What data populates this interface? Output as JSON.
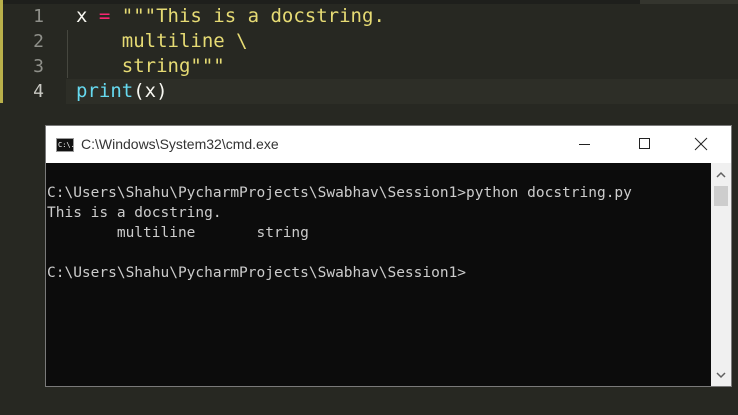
{
  "editor": {
    "line_numbers": [
      "1",
      "2",
      "3",
      "4"
    ],
    "lines": [
      {
        "var": "x",
        "op": " = ",
        "str": "\"\"\"This is a docstring."
      },
      {
        "str": "    multiline \\"
      },
      {
        "str": "    string\"\"\""
      },
      {
        "fn": "print",
        "open": "(",
        "arg": "x",
        "close": ")"
      }
    ]
  },
  "cmd": {
    "title": "C:\\Windows\\System32\\cmd.exe",
    "icon": "cmd-app-icon",
    "icon_text": "C:\\.",
    "console_lines": [
      "C:\\Users\\Shahu\\PycharmProjects\\Swabhav\\Session1>python docstring.py",
      "This is a docstring.",
      "        multiline       string",
      "",
      "C:\\Users\\Shahu\\PycharmProjects\\Swabhav\\Session1>"
    ]
  },
  "colors": {
    "editor_bg": "#272822",
    "keyword_pink": "#f92672",
    "string_yellow": "#e6db74",
    "function_cyan": "#66d9ef",
    "console_bg": "#0c0c0c",
    "console_text": "#cccccc"
  }
}
